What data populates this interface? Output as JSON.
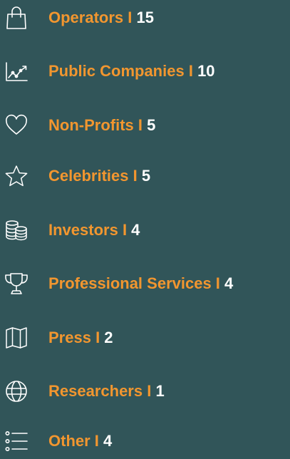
{
  "colors": {
    "background": "#315559",
    "accent": "#f2962f",
    "count": "#ffffff",
    "icon": "#ffffff"
  },
  "items": [
    {
      "label": "Operators",
      "separator": " I ",
      "count": "15",
      "icon": "shopping-bag-icon"
    },
    {
      "label": "Public Companies",
      "separator": " I ",
      "count": "10",
      "icon": "line-chart-icon"
    },
    {
      "label": "Non-Profits",
      "separator": " I ",
      "count": "5",
      "icon": "heart-icon"
    },
    {
      "label": "Celebrities",
      "separator": " I ",
      "count": "5",
      "icon": "star-icon"
    },
    {
      "label": "Investors",
      "separator": " I ",
      "count": "4",
      "icon": "coins-icon"
    },
    {
      "label": "Professional Services",
      "separator": " I ",
      "count": "4",
      "icon": "trophy-icon"
    },
    {
      "label": "Press",
      "separator": " I ",
      "count": "2",
      "icon": "map-icon"
    },
    {
      "label": "Researchers",
      "separator": " I ",
      "count": "1",
      "icon": "globe-icon"
    },
    {
      "label": "Other",
      "separator": " I ",
      "count": "4",
      "icon": "list-icon"
    }
  ]
}
